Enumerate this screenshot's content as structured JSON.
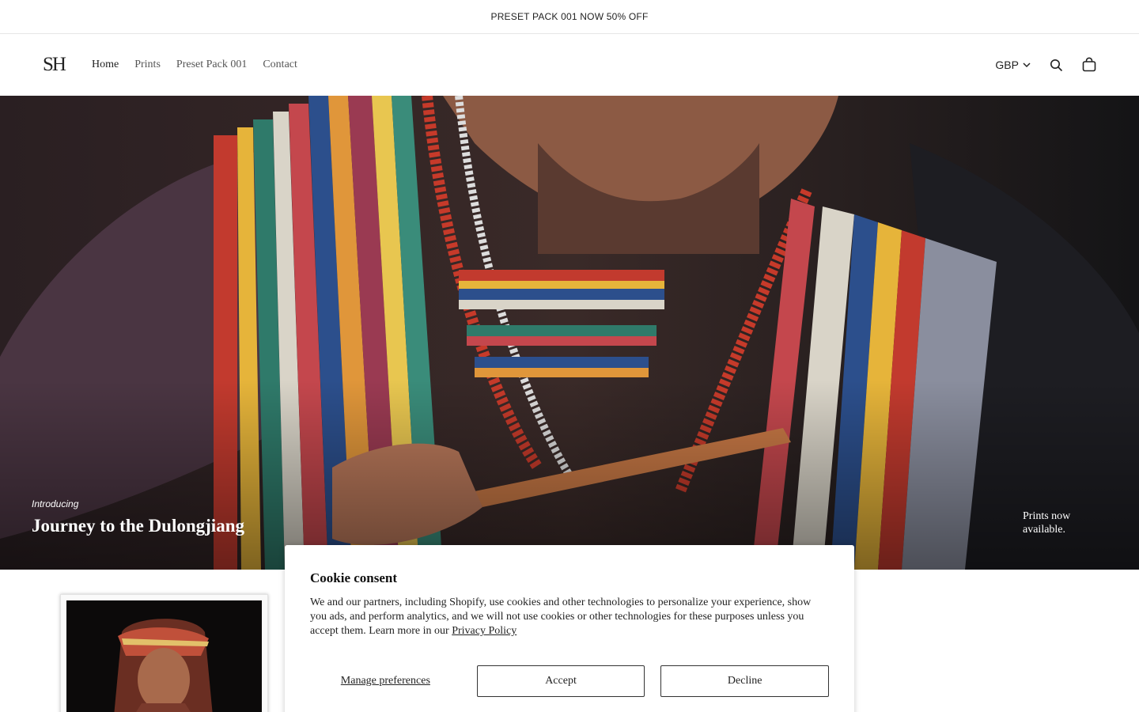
{
  "announcement": "PRESET PACK 001 NOW 50% OFF",
  "header": {
    "logo": "SH",
    "nav": [
      "Home",
      "Prints",
      "Preset Pack 001",
      "Contact"
    ],
    "currency": "GBP",
    "icons": [
      "chevron-down-icon",
      "search-icon",
      "cart-icon"
    ]
  },
  "hero": {
    "eyebrow": "Introducing",
    "title": "Journey to the Dulongjiang",
    "side_text": "Prints now available."
  },
  "cookie": {
    "title": "Cookie consent",
    "text": "We and our partners, including Shopify, use cookies and other technologies to personalize your experience, show you ads, and perform analytics, and we will not use cookies or other technologies for these purposes unless you accept them. Learn more in our ",
    "privacy_link": "Privacy Policy",
    "manage": "Manage preferences",
    "accept": "Accept",
    "decline": "Decline"
  }
}
